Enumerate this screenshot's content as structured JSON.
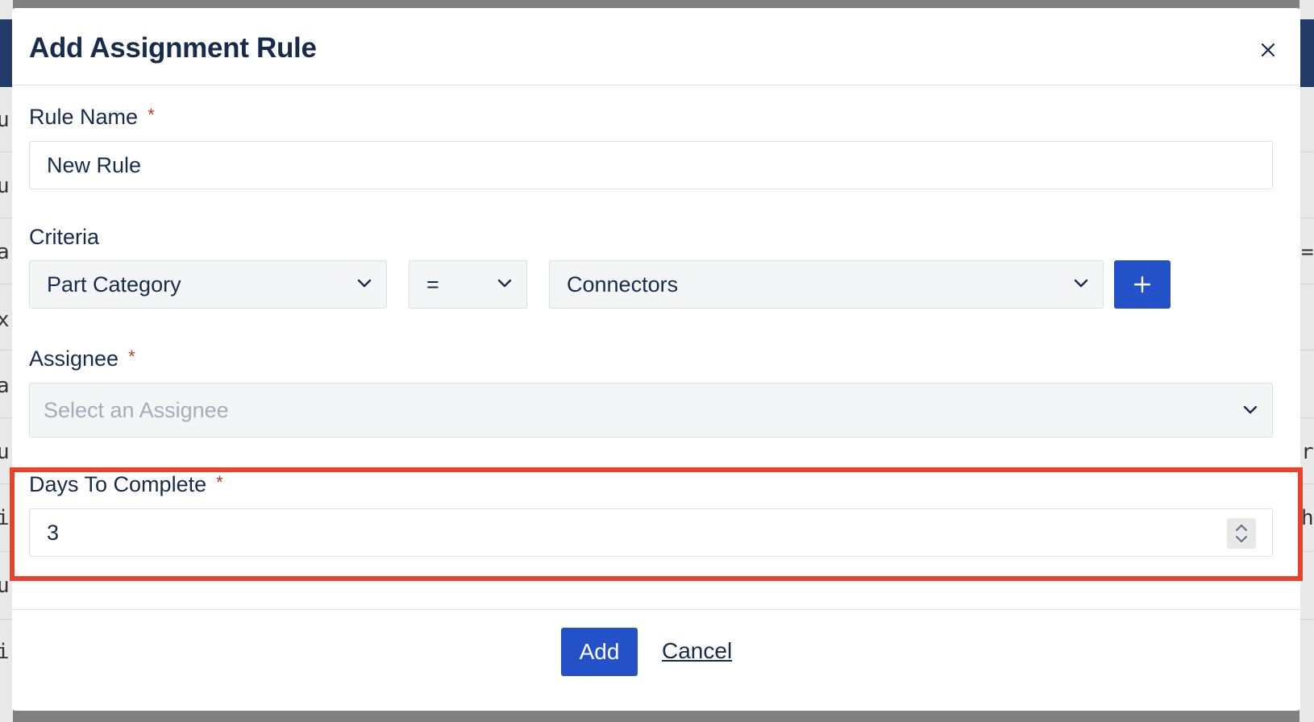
{
  "modal": {
    "title": "Add Assignment Rule",
    "close_icon": "close-icon"
  },
  "rule_name": {
    "label": "Rule Name",
    "required_mark": "*",
    "value": "New Rule"
  },
  "criteria": {
    "label": "Criteria",
    "field_select": "Part Category",
    "operator_select": "=",
    "value_select": "Connectors",
    "add_icon": "plus-icon"
  },
  "assignee": {
    "label": "Assignee",
    "required_mark": "*",
    "placeholder": "Select an Assignee"
  },
  "days_to_complete": {
    "label": "Days To Complete",
    "required_mark": "*",
    "value": "3"
  },
  "footer": {
    "add_label": "Add",
    "cancel_label": "Cancel"
  },
  "background": {
    "left_chars": [
      "u",
      "u",
      "a",
      "x",
      "a",
      "u",
      "i",
      "u",
      "i"
    ],
    "right_chars": [
      "=",
      "r",
      "h"
    ]
  },
  "colors": {
    "primary": "#2251c8",
    "highlight": "#e8432a",
    "required": "#c0392b",
    "text": "#172b4d"
  }
}
